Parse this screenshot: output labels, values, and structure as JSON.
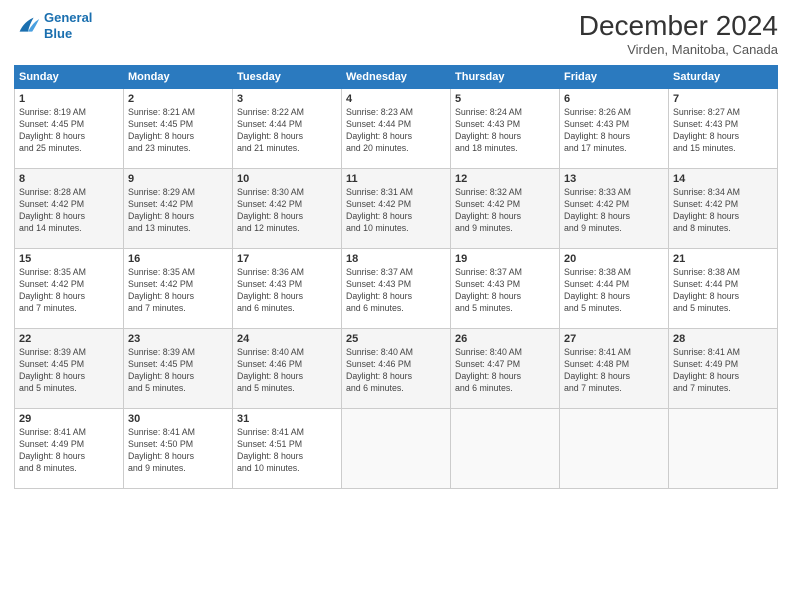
{
  "header": {
    "logo_line1": "General",
    "logo_line2": "Blue",
    "month_title": "December 2024",
    "location": "Virden, Manitoba, Canada"
  },
  "days_of_week": [
    "Sunday",
    "Monday",
    "Tuesday",
    "Wednesday",
    "Thursday",
    "Friday",
    "Saturday"
  ],
  "weeks": [
    [
      {
        "day": "1",
        "info": "Sunrise: 8:19 AM\nSunset: 4:45 PM\nDaylight: 8 hours\nand 25 minutes."
      },
      {
        "day": "2",
        "info": "Sunrise: 8:21 AM\nSunset: 4:45 PM\nDaylight: 8 hours\nand 23 minutes."
      },
      {
        "day": "3",
        "info": "Sunrise: 8:22 AM\nSunset: 4:44 PM\nDaylight: 8 hours\nand 21 minutes."
      },
      {
        "day": "4",
        "info": "Sunrise: 8:23 AM\nSunset: 4:44 PM\nDaylight: 8 hours\nand 20 minutes."
      },
      {
        "day": "5",
        "info": "Sunrise: 8:24 AM\nSunset: 4:43 PM\nDaylight: 8 hours\nand 18 minutes."
      },
      {
        "day": "6",
        "info": "Sunrise: 8:26 AM\nSunset: 4:43 PM\nDaylight: 8 hours\nand 17 minutes."
      },
      {
        "day": "7",
        "info": "Sunrise: 8:27 AM\nSunset: 4:43 PM\nDaylight: 8 hours\nand 15 minutes."
      }
    ],
    [
      {
        "day": "8",
        "info": "Sunrise: 8:28 AM\nSunset: 4:42 PM\nDaylight: 8 hours\nand 14 minutes."
      },
      {
        "day": "9",
        "info": "Sunrise: 8:29 AM\nSunset: 4:42 PM\nDaylight: 8 hours\nand 13 minutes."
      },
      {
        "day": "10",
        "info": "Sunrise: 8:30 AM\nSunset: 4:42 PM\nDaylight: 8 hours\nand 12 minutes."
      },
      {
        "day": "11",
        "info": "Sunrise: 8:31 AM\nSunset: 4:42 PM\nDaylight: 8 hours\nand 10 minutes."
      },
      {
        "day": "12",
        "info": "Sunrise: 8:32 AM\nSunset: 4:42 PM\nDaylight: 8 hours\nand 9 minutes."
      },
      {
        "day": "13",
        "info": "Sunrise: 8:33 AM\nSunset: 4:42 PM\nDaylight: 8 hours\nand 9 minutes."
      },
      {
        "day": "14",
        "info": "Sunrise: 8:34 AM\nSunset: 4:42 PM\nDaylight: 8 hours\nand 8 minutes."
      }
    ],
    [
      {
        "day": "15",
        "info": "Sunrise: 8:35 AM\nSunset: 4:42 PM\nDaylight: 8 hours\nand 7 minutes."
      },
      {
        "day": "16",
        "info": "Sunrise: 8:35 AM\nSunset: 4:42 PM\nDaylight: 8 hours\nand 7 minutes."
      },
      {
        "day": "17",
        "info": "Sunrise: 8:36 AM\nSunset: 4:43 PM\nDaylight: 8 hours\nand 6 minutes."
      },
      {
        "day": "18",
        "info": "Sunrise: 8:37 AM\nSunset: 4:43 PM\nDaylight: 8 hours\nand 6 minutes."
      },
      {
        "day": "19",
        "info": "Sunrise: 8:37 AM\nSunset: 4:43 PM\nDaylight: 8 hours\nand 5 minutes."
      },
      {
        "day": "20",
        "info": "Sunrise: 8:38 AM\nSunset: 4:44 PM\nDaylight: 8 hours\nand 5 minutes."
      },
      {
        "day": "21",
        "info": "Sunrise: 8:38 AM\nSunset: 4:44 PM\nDaylight: 8 hours\nand 5 minutes."
      }
    ],
    [
      {
        "day": "22",
        "info": "Sunrise: 8:39 AM\nSunset: 4:45 PM\nDaylight: 8 hours\nand 5 minutes."
      },
      {
        "day": "23",
        "info": "Sunrise: 8:39 AM\nSunset: 4:45 PM\nDaylight: 8 hours\nand 5 minutes."
      },
      {
        "day": "24",
        "info": "Sunrise: 8:40 AM\nSunset: 4:46 PM\nDaylight: 8 hours\nand 5 minutes."
      },
      {
        "day": "25",
        "info": "Sunrise: 8:40 AM\nSunset: 4:46 PM\nDaylight: 8 hours\nand 6 minutes."
      },
      {
        "day": "26",
        "info": "Sunrise: 8:40 AM\nSunset: 4:47 PM\nDaylight: 8 hours\nand 6 minutes."
      },
      {
        "day": "27",
        "info": "Sunrise: 8:41 AM\nSunset: 4:48 PM\nDaylight: 8 hours\nand 7 minutes."
      },
      {
        "day": "28",
        "info": "Sunrise: 8:41 AM\nSunset: 4:49 PM\nDaylight: 8 hours\nand 7 minutes."
      }
    ],
    [
      {
        "day": "29",
        "info": "Sunrise: 8:41 AM\nSunset: 4:49 PM\nDaylight: 8 hours\nand 8 minutes."
      },
      {
        "day": "30",
        "info": "Sunrise: 8:41 AM\nSunset: 4:50 PM\nDaylight: 8 hours\nand 9 minutes."
      },
      {
        "day": "31",
        "info": "Sunrise: 8:41 AM\nSunset: 4:51 PM\nDaylight: 8 hours\nand 10 minutes."
      },
      {
        "day": "",
        "info": ""
      },
      {
        "day": "",
        "info": ""
      },
      {
        "day": "",
        "info": ""
      },
      {
        "day": "",
        "info": ""
      }
    ]
  ]
}
